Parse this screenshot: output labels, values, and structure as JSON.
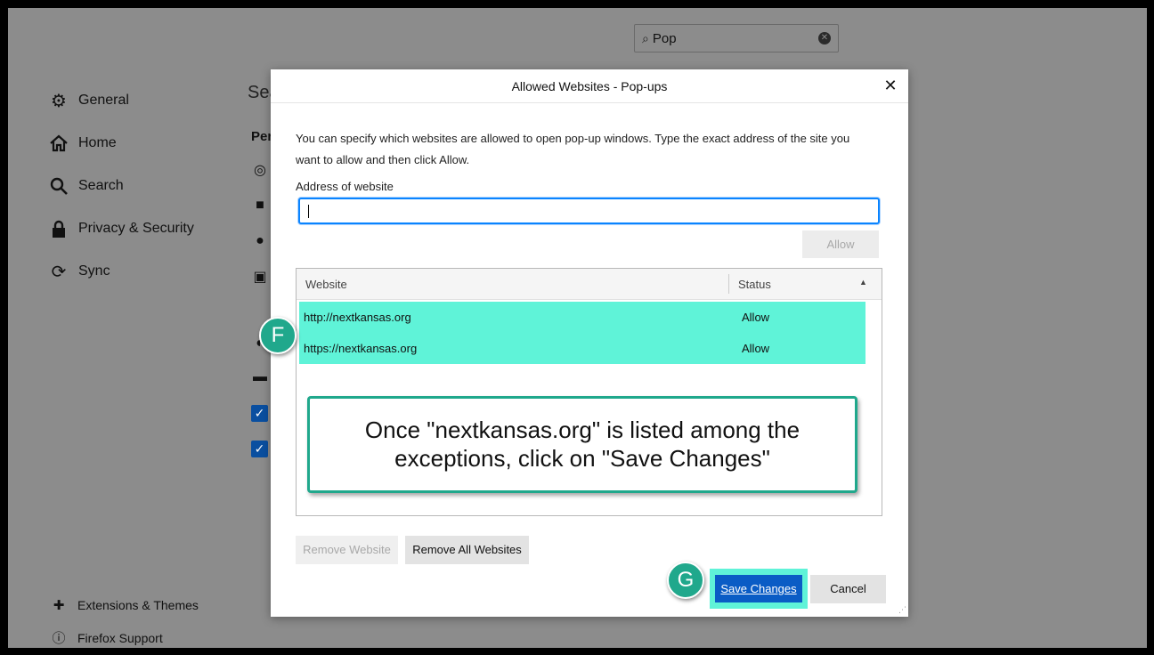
{
  "search": {
    "value": "Pop"
  },
  "nav": {
    "items": [
      {
        "label": "General",
        "icon": "gear-icon"
      },
      {
        "label": "Home",
        "icon": "home-icon"
      },
      {
        "label": "Search",
        "icon": "search-icon"
      },
      {
        "label": "Privacy & Security",
        "icon": "lock-icon"
      },
      {
        "label": "Sync",
        "icon": "sync-icon"
      }
    ],
    "bottom": [
      {
        "label": "Extensions & Themes",
        "icon": "puzzle-icon"
      },
      {
        "label": "Firefox Support",
        "icon": "help-icon"
      }
    ]
  },
  "background": {
    "heading": "Sea",
    "subheading": "Per"
  },
  "dialog": {
    "title": "Allowed Websites - Pop-ups",
    "description": "You can specify which websites are allowed to open pop-up windows. Type the exact address of the site you want to allow and then click Allow.",
    "address_label": "Address of website",
    "address_value": "",
    "allow_label": "Allow",
    "table": {
      "columns": [
        "Website",
        "Status"
      ],
      "rows": [
        {
          "website": "http://nextkansas.org",
          "status": "Allow"
        },
        {
          "website": "https://nextkansas.org",
          "status": "Allow"
        }
      ]
    },
    "remove_label": "Remove Website",
    "remove_all_label": "Remove All Websites",
    "save_label": "Save Changes",
    "cancel_label": "Cancel"
  },
  "annotation": {
    "callout_line1": "Once \"nextkansas.org\" is listed among the",
    "callout_line2": "exceptions, click on \"Save Changes\"",
    "badge_f": "F",
    "badge_g": "G",
    "highlight_color": "#5ff3d8",
    "badge_color": "#20a88c"
  }
}
